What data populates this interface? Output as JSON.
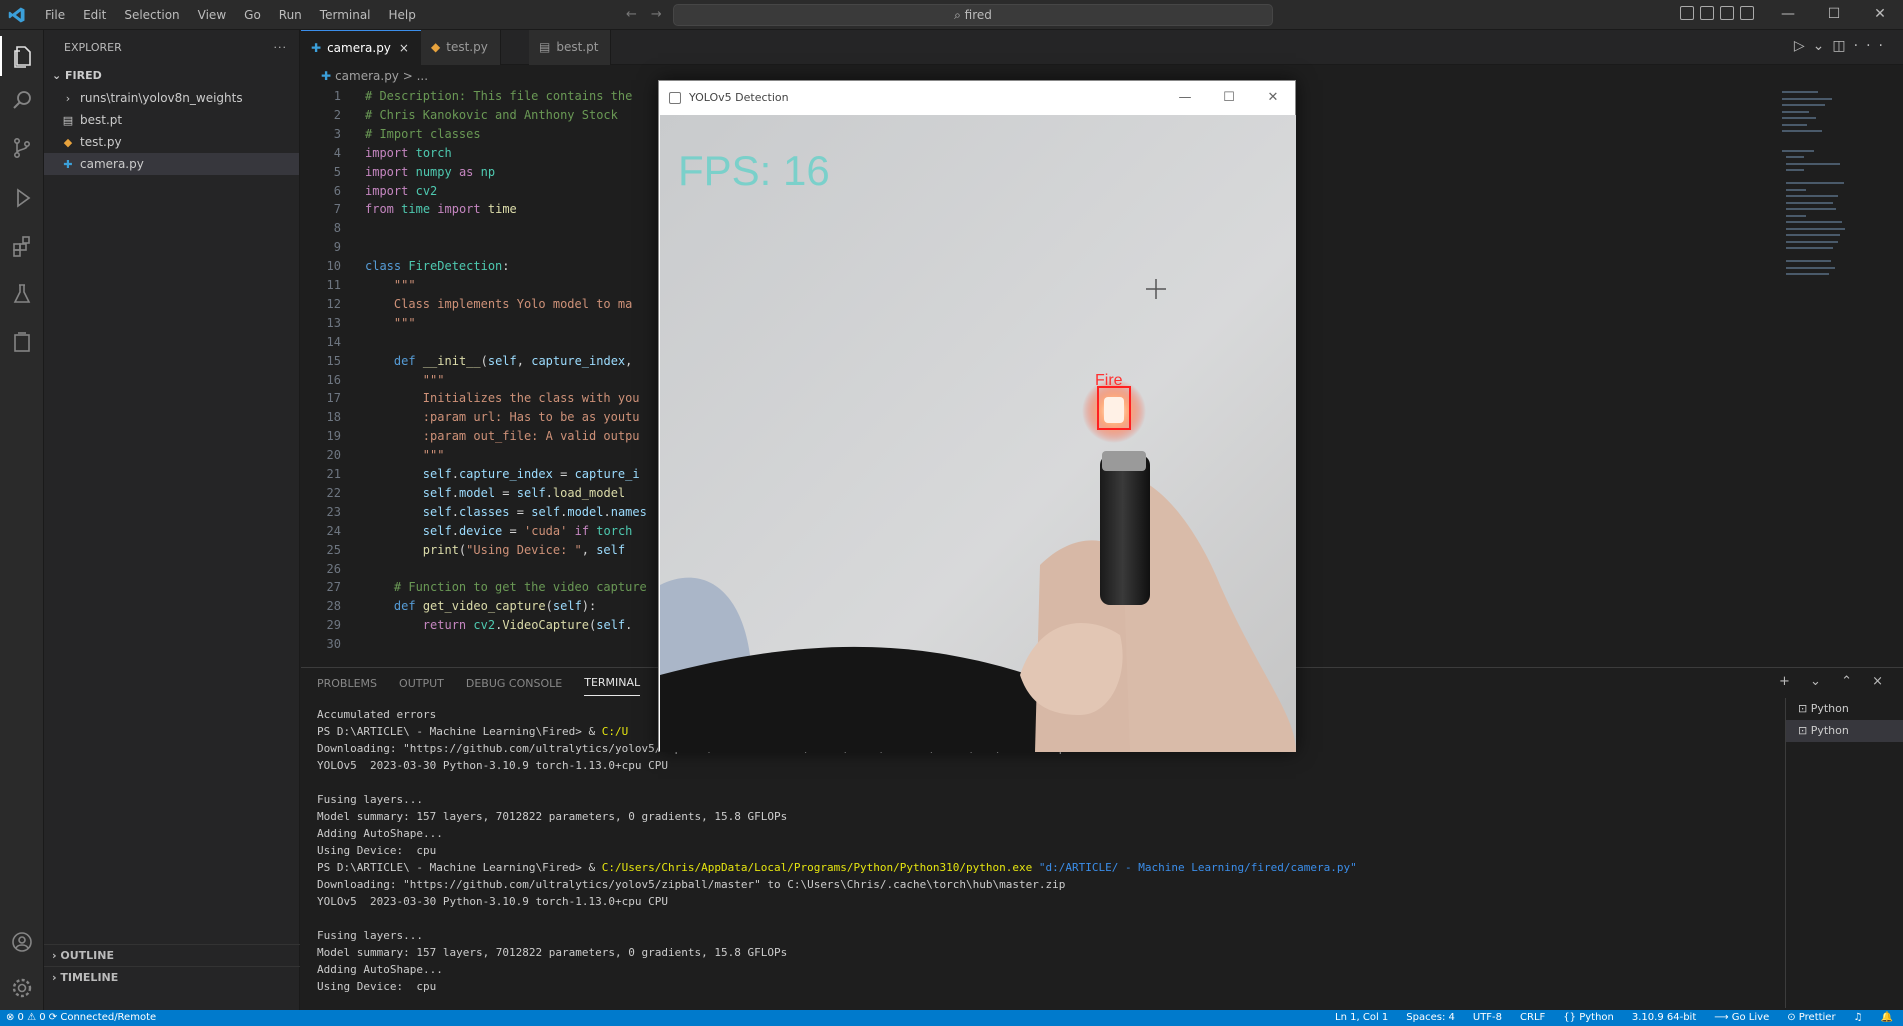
{
  "app": {
    "menus": [
      "File",
      "Edit",
      "Selection",
      "View",
      "Go",
      "Run",
      "Terminal",
      "Help"
    ],
    "command_center": "fired"
  },
  "sidebar": {
    "header": "EXPLORER",
    "more": "···",
    "root": "FIRED",
    "items": [
      {
        "label": "runs\\train\\yolov8n_weights",
        "icon": "folder-icon"
      },
      {
        "label": "best.pt",
        "icon": "file-icon"
      },
      {
        "label": "test.py",
        "icon": "python-icon"
      },
      {
        "label": "camera.py",
        "icon": "python-icon"
      }
    ],
    "outline_sections": [
      "OUTLINE",
      "TIMELINE"
    ]
  },
  "editor": {
    "tabs": [
      {
        "label": "camera.py",
        "close": "×"
      },
      {
        "label": "test.py"
      },
      {
        "label": "best.pt"
      }
    ],
    "breadcrumb": "camera.py > ...",
    "lines": [
      {
        "n": "1",
        "html": "<span class='cm'># Description: This file contains the</span>"
      },
      {
        "n": "2",
        "html": "<span class='cm'># Chris Kanokovic and Anthony Stock</span>"
      },
      {
        "n": "3",
        "html": "<span class='cm'># Import classes</span>"
      },
      {
        "n": "4",
        "html": "<span class='kw'>import</span> <span class='cls'>torch</span>"
      },
      {
        "n": "5",
        "html": "<span class='kw'>import</span> <span class='cls'>numpy</span> <span class='kw'>as</span> <span class='cls'>np</span>"
      },
      {
        "n": "6",
        "html": "<span class='kw'>import</span> <span class='cls'>cv2</span>"
      },
      {
        "n": "7",
        "html": "<span class='kw'>from</span> <span class='cls'>time</span> <span class='kw'>import</span> <span class='fn'>time</span>"
      },
      {
        "n": "8",
        "html": ""
      },
      {
        "n": "9",
        "html": ""
      },
      {
        "n": "10",
        "html": "<span class='dk'>class</span> <span class='cls'>FireDetection</span><span class='tx'>:</span>"
      },
      {
        "n": "11",
        "html": "    <span class='st'>\"\"\"</span>"
      },
      {
        "n": "12",
        "html": "    <span class='st'>Class implements Yolo model to ma</span>"
      },
      {
        "n": "13",
        "html": "    <span class='st'>\"\"\"</span>"
      },
      {
        "n": "14",
        "html": ""
      },
      {
        "n": "15",
        "html": "    <span class='dk'>def</span> <span class='fn'>__init__</span><span class='tx'>(</span><span class='vr'>self</span><span class='tx'>, </span><span class='vr'>capture_index</span><span class='tx'>,</span>"
      },
      {
        "n": "16",
        "html": "        <span class='st'>\"\"\"</span>"
      },
      {
        "n": "17",
        "html": "        <span class='st'>Initializes the class with you</span>"
      },
      {
        "n": "18",
        "html": "        <span class='st'>:param url: Has to be as youtu</span>"
      },
      {
        "n": "19",
        "html": "        <span class='st'>:param out_file: A valid outpu</span>"
      },
      {
        "n": "20",
        "html": "        <span class='st'>\"\"\"</span>"
      },
      {
        "n": "21",
        "html": "        <span class='vr'>self</span><span class='tx'>.</span><span class='vr'>capture_index</span> <span class='tx'>=</span> <span class='vr'>capture_i</span>"
      },
      {
        "n": "22",
        "html": "        <span class='vr'>self</span><span class='tx'>.</span><span class='vr'>model</span> <span class='tx'>=</span> <span class='vr'>self</span><span class='tx'>.</span><span class='fn'>load_model</span>"
      },
      {
        "n": "23",
        "html": "        <span class='vr'>self</span><span class='tx'>.</span><span class='vr'>classes</span> <span class='tx'>=</span> <span class='vr'>self</span><span class='tx'>.</span><span class='vr'>model</span><span class='tx'>.</span><span class='vr'>names</span>"
      },
      {
        "n": "24",
        "html": "        <span class='vr'>self</span><span class='tx'>.</span><span class='vr'>device</span> <span class='tx'>=</span> <span class='st'>'cuda'</span> <span class='kw'>if</span> <span class='cls'>torch</span>"
      },
      {
        "n": "25",
        "html": "        <span class='fn'>print</span><span class='tx'>(</span><span class='st'>\"Using Device: \"</span><span class='tx'>, </span><span class='vr'>self</span>"
      },
      {
        "n": "26",
        "html": ""
      },
      {
        "n": "27",
        "html": "    <span class='cm'># Function to get the video capture</span>"
      },
      {
        "n": "28",
        "html": "    <span class='dk'>def</span> <span class='fn'>get_video_capture</span><span class='tx'>(</span><span class='vr'>self</span><span class='tx'>):</span>"
      },
      {
        "n": "29",
        "html": "        <span class='kw'>return</span> <span class='cls'>cv2</span><span class='tx'>.</span><span class='fn'>VideoCapture</span><span class='tx'>(</span><span class='vr'>self</span><span class='tx'>.</span>"
      },
      {
        "n": "30",
        "html": ""
      }
    ]
  },
  "panel": {
    "tabs": [
      "PROBLEMS",
      "OUTPUT",
      "DEBUG CONSOLE",
      "TERMINAL"
    ],
    "active_tab": "TERMINAL",
    "actions": "+ ⌄ ⌃ ×",
    "terminal_lines": [
      {
        "html": "Accumulated errors"
      },
      {
        "html": "PS D:\\ARTICLE\\ - Machine Learning\\Fired> &amp; <span class='y'>C:/U</span>                                                                        <span class='c'>ning/fired/camera.py\"</span>"
      },
      {
        "html": "Downloading: \"https://github.com/ultralytics/yolov5/zipball/master\" to C:\\Users\\Chris/.cache\\torch\\hub\\master.zip"
      },
      {
        "html": "YOLOv5  2023-03-30 Python-3.10.9 torch-1.13.0+cpu CPU"
      },
      {
        "html": ""
      },
      {
        "html": "Fusing layers..."
      },
      {
        "html": "Model summary: 157 layers, 7012822 parameters, 0 gradients, 15.8 GFLOPs"
      },
      {
        "html": "Adding AutoShape..."
      },
      {
        "html": "Using Device:  cpu"
      },
      {
        "html": "PS D:\\ARTICLE\\ - Machine Learning\\Fired> &amp; <span class='y'>C:/Users/Chris/AppData/Local/Programs/Python/Python310/python.exe</span> <span class='c'>\"d:/ARTICLE/ - Machine Learning/fired/camera.py\"</span>"
      },
      {
        "html": "Downloading: \"https://github.com/ultralytics/yolov5/zipball/master\" to C:\\Users\\Chris/.cache\\torch\\hub\\master.zip"
      },
      {
        "html": "YOLOv5  2023-03-30 Python-3.10.9 torch-1.13.0+cpu CPU"
      },
      {
        "html": ""
      },
      {
        "html": "Fusing layers..."
      },
      {
        "html": "Model summary: 157 layers, 7012822 parameters, 0 gradients, 15.8 GFLOPs"
      },
      {
        "html": "Adding AutoShape..."
      },
      {
        "html": "Using Device:  cpu"
      }
    ],
    "terminal_list": [
      "Python",
      "Python"
    ]
  },
  "statusbar": {
    "left": "⊗ 0 ⚠ 0    ⟳ Connected/Remote",
    "right": [
      "Ln 1, Col 1",
      "Spaces: 4",
      "UTF-8",
      "CRLF",
      "{} Python",
      "3.10.9 64-bit",
      "⟶ Go Live",
      "⊙ Prettier",
      "♫",
      "🔔"
    ]
  },
  "camera_window": {
    "title": "YOLOv5 Detection",
    "fps_text": "FPS: 16",
    "detection_label": "Fire",
    "controls": [
      "—",
      "☐",
      "✕"
    ]
  },
  "colors": {
    "accent": "#007acc",
    "detection_box": "#ff2020",
    "fps_text": "#5fd0c8"
  }
}
